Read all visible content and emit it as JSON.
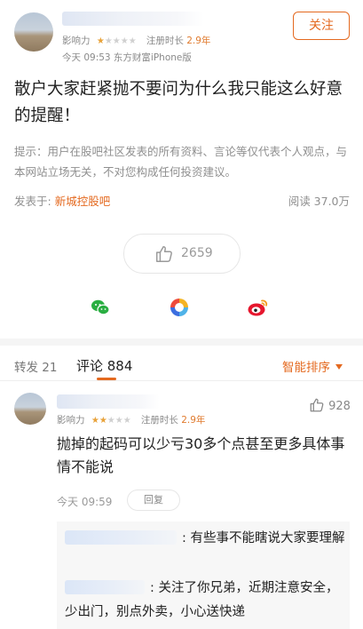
{
  "post": {
    "author": {
      "influence_label": "影响力",
      "rating": 1,
      "rating_max": 5,
      "age_label": "注册时长",
      "age_value": "2.9年"
    },
    "posted_info": "今天 09:53 东方财富iPhone版",
    "follow_label": "关注",
    "title": "散户大家赶紧抛不要问为什么我只能这么好意的提醒！",
    "notice": "提示：用户在股吧社区发表的所有资料、言论等仅代表个人观点，与本网站立场无关，不对您构成任何投资建议。",
    "source_prefix": "发表于:",
    "source_forum": "新城控股吧",
    "reads": "阅读 37.0万",
    "likes": "2659"
  },
  "share": {
    "icons": [
      "wechat-icon",
      "moments-icon",
      "weibo-icon"
    ]
  },
  "tabs": {
    "repost_label": "转发 21",
    "comment_label": "评论 884",
    "sort_label": "智能排序"
  },
  "comment": {
    "influence_label": "影响力",
    "rating": 2,
    "rating_max": 5,
    "age_label": "注册时长",
    "age_value": "2.9年",
    "likes": "928",
    "text": "抛掉的起码可以少亏30多个点甚至更多具体事情不能说",
    "time": "今天 09:59",
    "reply_label": "回复",
    "replies": [
      {
        "text": ": 有些事不能瞎说大家要理解"
      },
      {
        "text": ": 关注了你兄弟，近期注意安全，少出门，别点外卖，小心送快递"
      }
    ]
  },
  "colors": {
    "accent": "#e4691f",
    "star_on": "#e8a23a",
    "star_off": "#d0d0d0",
    "link": "#e4691f"
  }
}
